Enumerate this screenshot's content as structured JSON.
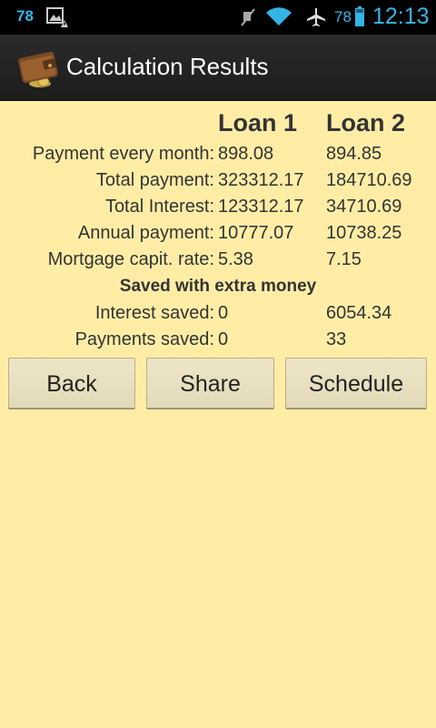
{
  "status_bar": {
    "notification_count": "78",
    "battery_level": "78",
    "time": "12:13",
    "icons": [
      "picture-warning-icon",
      "mute-icon",
      "wifi-icon",
      "airplane-icon",
      "battery-icon"
    ],
    "accent_color": "#33B5E5"
  },
  "action_bar": {
    "title": "Calculation Results",
    "icon": "wallet-icon"
  },
  "table": {
    "headers": {
      "loan1": "Loan 1",
      "loan2": "Loan 2"
    },
    "rows": [
      {
        "label": "Payment every month:",
        "loan1": "898.08",
        "loan2": "894.85"
      },
      {
        "label": "Total payment:",
        "loan1": "323312.17",
        "loan2": "184710.69"
      },
      {
        "label": "Total Interest:",
        "loan1": "123312.17",
        "loan2": "34710.69"
      },
      {
        "label": "Annual payment:",
        "loan1": "10777.07",
        "loan2": "10738.25"
      },
      {
        "label": "Mortgage capit. rate:",
        "loan1": "5.38",
        "loan2": "7.15"
      }
    ],
    "section_title": "Saved with extra money",
    "saved_rows": [
      {
        "label": "Interest saved:",
        "loan1": "0",
        "loan2": "6054.34"
      },
      {
        "label": "Payments saved:",
        "loan1": "0",
        "loan2": "33"
      }
    ]
  },
  "buttons": {
    "back": "Back",
    "share": "Share",
    "schedule": "Schedule"
  },
  "colors": {
    "background": "#FFEDA6",
    "button": "#E8E0C0",
    "action_bar": "#222222"
  }
}
